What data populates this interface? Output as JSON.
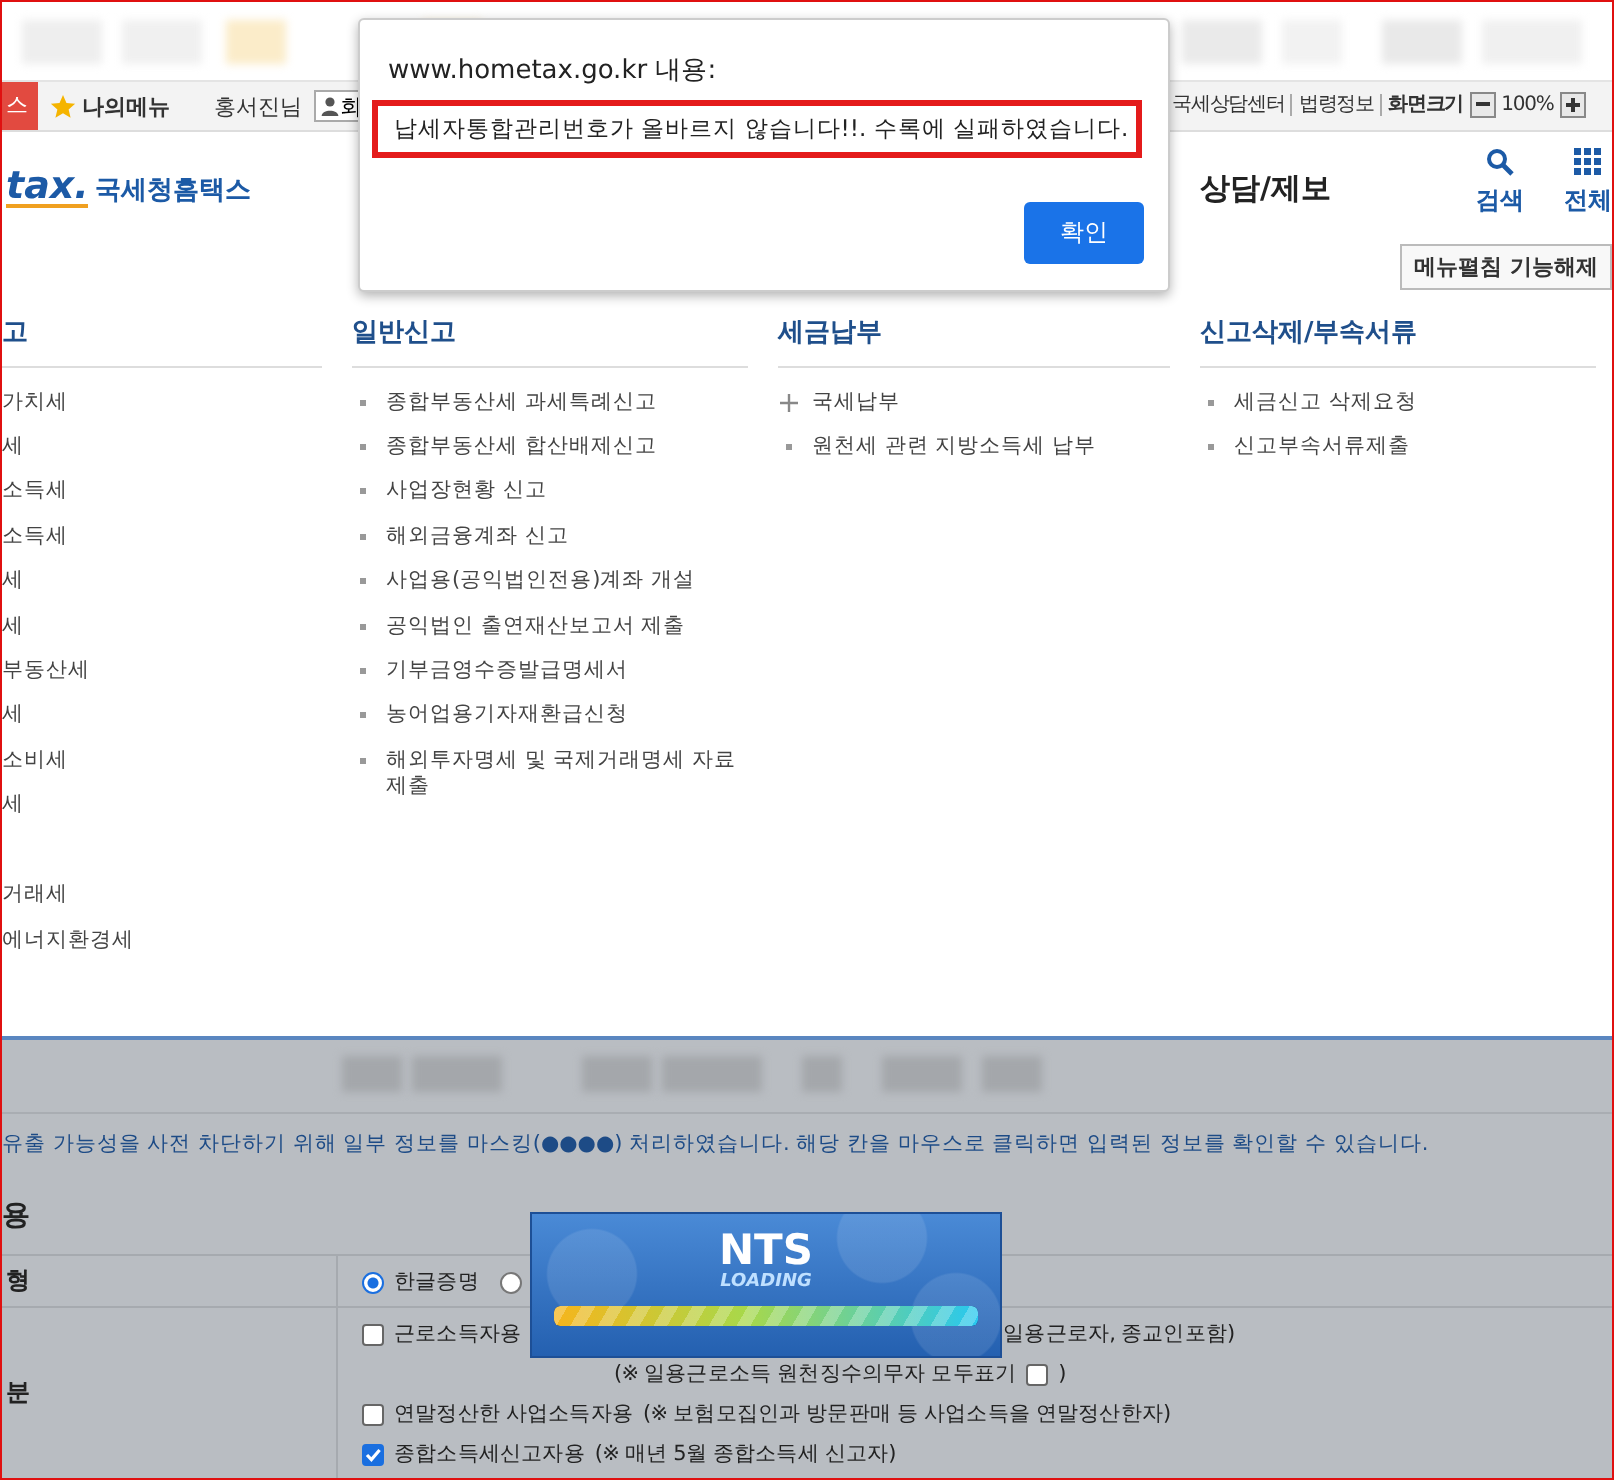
{
  "top_bar": {
    "left_tab": "스",
    "my_menu": "나의메뉴",
    "user_name": "홍서진님",
    "user_button": "회",
    "links": [
      "국세상담센터",
      "법령정보"
    ],
    "zoom_label": "화면크기",
    "zoom_value": "100%"
  },
  "header": {
    "logo": "tax.",
    "site_name": "국세청홈택스",
    "nav": [
      "상담/제보"
    ],
    "tools": [
      {
        "kind": "search",
        "label": "검색"
      },
      {
        "kind": "grid",
        "label": "전체"
      }
    ]
  },
  "menu_toggle_button": "메뉴펼침 기능해제",
  "menu_columns": [
    {
      "title": "고",
      "groups": [
        [
          {
            "kind": "plain",
            "label": "가치세"
          },
          {
            "kind": "plain",
            "label": "세"
          },
          {
            "kind": "plain",
            "label": "소득세"
          },
          {
            "kind": "plain",
            "label": "소득세"
          },
          {
            "kind": "plain",
            "label": "세"
          },
          {
            "kind": "plain",
            "label": "세"
          },
          {
            "kind": "plain",
            "label": "부동산세"
          },
          {
            "kind": "plain",
            "label": "세"
          },
          {
            "kind": "plain",
            "label": "소비세"
          },
          {
            "kind": "plain",
            "label": "세"
          }
        ],
        [
          {
            "kind": "plain",
            "label": "거래세"
          },
          {
            "kind": "plain",
            "label": "에너지환경세"
          }
        ]
      ]
    },
    {
      "title": "일반신고",
      "groups": [
        [
          {
            "kind": "bullet",
            "label": "종합부동산세 과세특례신고"
          },
          {
            "kind": "bullet",
            "label": "종합부동산세 합산배제신고"
          },
          {
            "kind": "bullet",
            "label": "사업장현황 신고"
          },
          {
            "kind": "bullet",
            "label": "해외금융계좌 신고"
          },
          {
            "kind": "bullet",
            "label": "사업용(공익법인전용)계좌 개설"
          },
          {
            "kind": "bullet",
            "label": "공익법인 출연재산보고서 제출"
          },
          {
            "kind": "bullet",
            "label": "기부금영수증발급명세서"
          },
          {
            "kind": "bullet",
            "label": "농어업용기자재환급신청"
          },
          {
            "kind": "bullet",
            "label": "해외투자명세 및 국제거래명세 자료 제출"
          }
        ]
      ]
    },
    {
      "title": "세금납부",
      "groups": [
        [
          {
            "kind": "expand",
            "label": "국세납부"
          },
          {
            "kind": "bullet",
            "label": "원천세 관련 지방소득세 납부"
          }
        ]
      ]
    },
    {
      "title": "신고삭제/부속서류",
      "groups": [
        [
          {
            "kind": "bullet",
            "label": "세금신고 삭제요청"
          },
          {
            "kind": "bullet",
            "label": "신고부속서류제출"
          }
        ]
      ]
    }
  ],
  "form": {
    "notice": "유출 가능성을 사전 차단하기 위해 일부 정보를 마스킹(●●●●) 처리하였습니다. 해당 칸을 마우스로 클릭하면 입력된 정보를 확인할 수 있습니다.",
    "section_title": "용",
    "rows": [
      {
        "label": "형",
        "lines": [
          {
            "kind": "radios",
            "radios": [
              {
                "label": "한글증명",
                "selected": true
              },
              {
                "selected": false
              }
            ]
          }
        ]
      },
      {
        "label": "분",
        "lines": [
          {
            "kind": "checkbox",
            "label": "근로소득자용",
            "checked": false,
            "note": "일용근로자, 종교인포함)",
            "note_far": true
          },
          {
            "kind": "subnote",
            "label": "(※ 일용근로소득 원천징수의무자 모두표기",
            "checked": false,
            "end": ")"
          },
          {
            "kind": "checkbox",
            "label": "연말정산한 사업소득자용",
            "checked": false,
            "note": "(※ 보험모집인과 방문판매 등 사업소득을 연말정산한자)",
            "note_far": false
          },
          {
            "kind": "checkbox",
            "label": "종합소득세신고자용",
            "checked": true,
            "note": "(※ 매년 5월 종합소득세 신고자)",
            "note_far": false
          }
        ]
      }
    ]
  },
  "loading": {
    "title": "NTS",
    "subtitle": "LOADING",
    "level": 1
  },
  "dialog": {
    "origin": "www.hometax.go.kr 내용:",
    "message": "납세자통합관리번호가 올바르지 않습니다!!. 수록에 실패하였습니다.",
    "ok_button": "확인"
  }
}
